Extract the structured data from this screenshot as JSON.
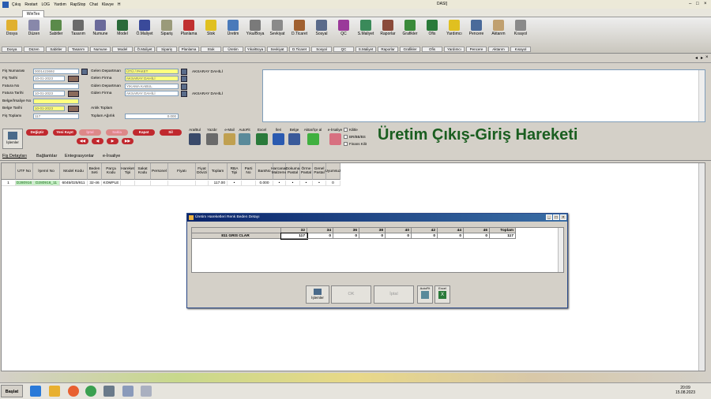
{
  "menubar": {
    "items": [
      "Çıkış",
      "Restart",
      "LOG",
      "Yardım",
      "RapStop",
      "Chat",
      "Klavye",
      "H"
    ],
    "title": "DASI]"
  },
  "window_tab": "WinTex",
  "toolbar": {
    "buttons": [
      {
        "label": "Dosya",
        "sub": "Dosya",
        "icon": "folder-icon",
        "color": "#e0b030"
      },
      {
        "label": "Düzen",
        "sub": "Düzen",
        "icon": "edit-icon",
        "color": "#8888aa"
      },
      {
        "label": "Sabitler",
        "sub": "Sabitler",
        "icon": "gear-icon",
        "color": "#5a8a4a"
      },
      {
        "label": "Tasarım",
        "sub": "Tasarım",
        "icon": "design-icon",
        "color": "#6a6a6a"
      },
      {
        "label": "Numune",
        "sub": "Numune",
        "icon": "sample-icon",
        "color": "#6a6a9a"
      },
      {
        "label": "Model",
        "sub": "Model",
        "icon": "model-icon",
        "color": "#2a6a3a"
      },
      {
        "label": "Ö.Maliyet",
        "sub": "Ö.Maliyet",
        "icon": "cost-icon",
        "color": "#3a4a9a"
      },
      {
        "label": "Sipariş",
        "sub": "Sipariş",
        "icon": "order-icon",
        "color": "#9a9a7a"
      },
      {
        "label": "Planlama",
        "sub": "Planlama",
        "icon": "planning-icon",
        "color": "#c03030"
      },
      {
        "label": "Stok",
        "sub": "Stok",
        "icon": "star-icon",
        "color": "#e0c020"
      },
      {
        "label": "Üretim",
        "sub": "Üretim",
        "icon": "production-icon",
        "color": "#4a7aba"
      },
      {
        "label": "Yıka/Boya",
        "sub": "Yıka/Boya",
        "icon": "wash-icon",
        "color": "#7a7a7a"
      },
      {
        "label": "Sevkiyat",
        "sub": "Sevkiyat",
        "icon": "shipping-icon",
        "color": "#8a8a8a"
      },
      {
        "label": "D.Ticaret",
        "sub": "D.Ticaret",
        "icon": "trade-icon",
        "color": "#a06030"
      },
      {
        "label": "Sosyal",
        "sub": "Sosyal",
        "icon": "social-icon",
        "color": "#5a6a8a"
      },
      {
        "label": "QC",
        "sub": "QC",
        "icon": "qc-icon",
        "color": "#9a3a9a"
      },
      {
        "label": "S.Maliyet",
        "sub": "S.Maliyet",
        "icon": "cost2-icon",
        "color": "#3a8a5a"
      },
      {
        "label": "Raporlar",
        "sub": "Raporlar",
        "icon": "report-icon",
        "color": "#8a4a3a"
      },
      {
        "label": "Grafikler",
        "sub": "Grafikler",
        "icon": "chart-icon",
        "color": "#3a8a3a"
      },
      {
        "label": "Ofis",
        "sub": "Ofis",
        "icon": "excel-icon",
        "color": "#2a7a3a"
      },
      {
        "label": "Yardımcı",
        "sub": "Yardımcı",
        "icon": "smiley-icon",
        "color": "#e0c020"
      },
      {
        "label": "Pencere",
        "sub": "Pencere",
        "icon": "window-icon",
        "color": "#4a6a9a"
      },
      {
        "label": "Aktarım",
        "sub": "Aktarım",
        "icon": "transfer-icon",
        "color": "#c0a070"
      },
      {
        "label": "Kısayol",
        "sub": "Kısayol",
        "icon": "shortcut-icon",
        "color": "#8a8a8a"
      }
    ]
  },
  "form": {
    "fis_numarasi": {
      "label": "Fiş Numarası",
      "value": "0001423692"
    },
    "fis_tarihi": {
      "label": "Fiş Tarihi",
      "value": "10-01-2023"
    },
    "fatura_no": {
      "label": "Fatura No",
      "value": ""
    },
    "fatura_tarihi": {
      "label": "Fatura Tarihi",
      "value": "10-01-2023"
    },
    "belge_no": {
      "label": "Belge/İrsaliye No",
      "value": ""
    },
    "belge_tarihi": {
      "label": "Belge Tarihi",
      "value": "10-01-2023"
    },
    "fis_toplami": {
      "label": "Fiş Toplamı",
      "value": "117"
    },
    "gelen_departman": {
      "label": "Gelen Departman",
      "value": "ÜTÜ / PAKET"
    },
    "gelen_firma": {
      "label": "Gelen Firma",
      "value": "AKSARAY DAHİLİ",
      "extra": "AKSARAY DAHİLİ"
    },
    "giden_departman": {
      "label": "Giden Departman",
      "value": "YIKAMA KABUL"
    },
    "giden_firma": {
      "label": "Giden Firma",
      "value": "AKSARAY DAHİLİ",
      "extra": "AKSARAY DAHİLİ"
    },
    "anlik_toplam": {
      "label": "Anlık Toplam",
      "value": ""
    },
    "toplam_agirlik": {
      "label": "Toplam Ağırlık",
      "value": "0.000"
    }
  },
  "actions": {
    "islemler": "İşlemler",
    "pills": [
      {
        "label": "Değiştir",
        "enabled": true
      },
      {
        "label": "Yeni Kayıt",
        "enabled": true
      },
      {
        "label": "İptal",
        "enabled": false
      },
      {
        "label": "Sakla",
        "enabled": false
      },
      {
        "label": "Kapat",
        "enabled": true
      },
      {
        "label": "Sil",
        "enabled": true
      }
    ],
    "tools": [
      {
        "label": "Ara/Bul",
        "icon": "binoculars-icon"
      },
      {
        "label": "Yazdır",
        "icon": "printer-icon"
      },
      {
        "label": "e-Mail",
        "icon": "email-icon"
      },
      {
        "label": "AutoFit",
        "icon": "autofit-icon"
      },
      {
        "label": "Excel",
        "icon": "excel-icon"
      },
      {
        "label": "İleri",
        "icon": "forward-icon"
      },
      {
        "label": "Belge",
        "icon": "document-icon"
      },
      {
        "label": "Aktar/İçe al",
        "icon": "refresh-icon"
      },
      {
        "label": "e-İrsaliye",
        "icon": "eraser-icon"
      }
    ],
    "checks": [
      {
        "label": "Kilitle",
        "checked": false
      },
      {
        "label": "BR/BB/BS",
        "checked": false
      },
      {
        "label": "Finans Kilit",
        "checked": false
      }
    ]
  },
  "page_title": "Üretim Çıkış-Giriş Hareketi",
  "detail_tabs": [
    "Fiş Detayları",
    "Bağlantılar",
    "Entegrasyonlar",
    "e-İrsaliye"
  ],
  "grid": {
    "columns": [
      "",
      "UTF No",
      "İşemri No",
      "Model Kodu",
      "Beden Seti",
      "Parça Kodu",
      "Hareket Tipi",
      "Sakat Kodu",
      "Personel",
      "Fiyatı",
      "Fiyat Dövizi",
      "Toplam",
      "RBA Tipi",
      "Parti No",
      "BantNo",
      "Harcanan Malzeme",
      "Dokuma Pastal",
      "Örme Pastal",
      "Genel Pastal",
      "Uyumsuz"
    ],
    "rows": [
      [
        "1",
        "D280916",
        "D280916_11",
        "6045/025/811",
        "32-46",
        "KOMPLE",
        "",
        "",
        "",
        "",
        "",
        "117.00",
        "•",
        "",
        "0.000",
        "•",
        "•",
        "•",
        "•",
        "0"
      ]
    ]
  },
  "dialog": {
    "title": "Üretim Hareketleri Renk Beden Detayı",
    "headers": [
      "",
      "32",
      "34",
      "36",
      "38",
      "40",
      "42",
      "44",
      "46",
      "Toplam"
    ],
    "row": [
      "811 GRIS CLAR",
      "117",
      "0",
      "0",
      "0",
      "0",
      "0",
      "0",
      "0",
      "117"
    ],
    "buttons": {
      "islemler": "İşlemler",
      "ok": "OK",
      "iptal": "İptal",
      "autofit": "AutoFit",
      "excel": "Excel"
    }
  },
  "taskbar": {
    "start": "Başlat",
    "time": "20:09",
    "date": "15.08.2023"
  }
}
